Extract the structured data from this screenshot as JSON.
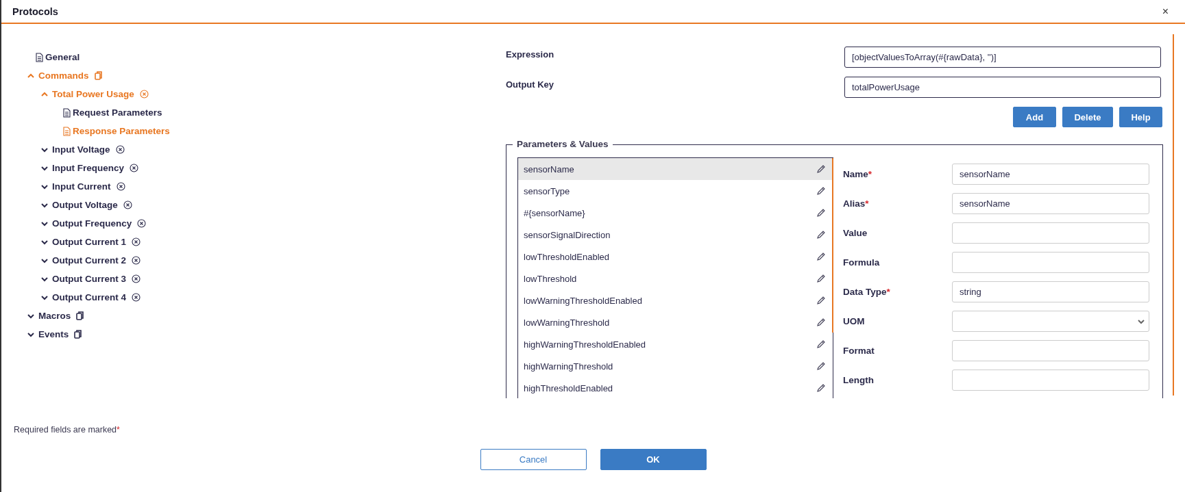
{
  "window": {
    "title": "Protocols",
    "close": "×"
  },
  "tree": [
    {
      "label": "General",
      "kind": "page",
      "selected": false
    },
    {
      "label": "Commands",
      "kind": "group",
      "expanded": true,
      "children": [
        {
          "label": "Total Power Usage",
          "kind": "command",
          "expanded": true,
          "children": [
            {
              "label": "Request Parameters",
              "kind": "page",
              "selected": false
            },
            {
              "label": "Response Parameters",
              "kind": "page",
              "selected": true
            }
          ]
        },
        {
          "label": "Input Voltage",
          "kind": "command",
          "expanded": false
        },
        {
          "label": "Input Frequency",
          "kind": "command",
          "expanded": false
        },
        {
          "label": "Input Current",
          "kind": "command",
          "expanded": false
        },
        {
          "label": "Output Voltage",
          "kind": "command",
          "expanded": false
        },
        {
          "label": "Output Frequency",
          "kind": "command",
          "expanded": false
        },
        {
          "label": "Output Current 1",
          "kind": "command",
          "expanded": false
        },
        {
          "label": "Output Current 2",
          "kind": "command",
          "expanded": false
        },
        {
          "label": "Output Current 3",
          "kind": "command",
          "expanded": false
        },
        {
          "label": "Output Current 4",
          "kind": "command",
          "expanded": false
        }
      ]
    },
    {
      "label": "Macros",
      "kind": "group",
      "expanded": false
    },
    {
      "label": "Events",
      "kind": "group",
      "expanded": false
    }
  ],
  "command_form": {
    "fields": [
      {
        "label": "Expression",
        "value": "[objectValuesToArray(#{rawData}, '')]"
      },
      {
        "label": "Output Key",
        "value": "totalPowerUsage"
      }
    ],
    "buttons": [
      "Add",
      "Delete",
      "Help"
    ]
  },
  "parameters": {
    "legend": "Parameters & Values",
    "items": [
      {
        "name": "sensorName",
        "selected": true
      },
      {
        "name": "sensorType",
        "selected": false
      },
      {
        "name": "#{sensorName}",
        "selected": false
      },
      {
        "name": "sensorSignalDirection",
        "selected": false
      },
      {
        "name": "lowThresholdEnabled",
        "selected": false
      },
      {
        "name": "lowThreshold",
        "selected": false
      },
      {
        "name": "lowWarningThresholdEnabled",
        "selected": false
      },
      {
        "name": "lowWarningThreshold",
        "selected": false
      },
      {
        "name": "highWarningThresholdEnabled",
        "selected": false
      },
      {
        "name": "highWarningThreshold",
        "selected": false
      },
      {
        "name": "highThresholdEnabled",
        "selected": false
      }
    ],
    "details": [
      {
        "label": "Name",
        "required_mark": "*",
        "kind": "text",
        "value": "sensorName"
      },
      {
        "label": "Alias",
        "required_mark": "*",
        "kind": "text",
        "value": "sensorName"
      },
      {
        "label": "Value",
        "kind": "text"
      },
      {
        "label": "Formula",
        "kind": "text"
      },
      {
        "label": "Data Type",
        "required_mark": "*",
        "kind": "text",
        "value": "string"
      },
      {
        "label": "UOM",
        "kind": "select"
      },
      {
        "label": "Format",
        "kind": "text"
      },
      {
        "label": "Length",
        "kind": "text"
      }
    ]
  },
  "footer": {
    "note": "Required fields are marked",
    "note_mark": "*",
    "buttons": [
      {
        "label": "Cancel",
        "kind": "secondary"
      },
      {
        "label": "OK",
        "kind": "primary"
      }
    ]
  }
}
